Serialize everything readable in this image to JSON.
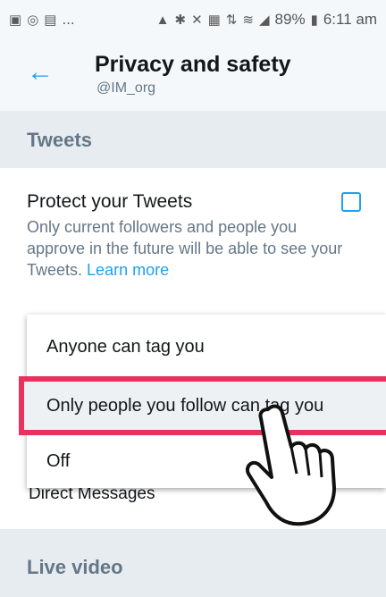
{
  "status_bar": {
    "left_text": "...",
    "battery": "89%",
    "time": "6:11 am"
  },
  "header": {
    "title": "Privacy and safety",
    "handle": "@IM_org",
    "back_icon": "arrow-left-icon"
  },
  "sections": {
    "tweets": "Tweets",
    "direct_messages": "Direct Messages",
    "live_video": "Live video"
  },
  "protect_tweets": {
    "title": "Protect your Tweets",
    "description": "Only current followers and people you approve in the future will be able to see your Tweets.",
    "learn_more": "Learn more",
    "checked": false
  },
  "photo_tagging_menu": {
    "options": [
      "Anyone can tag you",
      "Only people you follow can tag you",
      "Off"
    ],
    "highlighted_option": "Only people you follow can tag you"
  },
  "colors": {
    "accent": "#1da1f2",
    "highlight_border": "#e8315f",
    "section_bg": "#e6ecf0"
  },
  "cursor_icon": "hand-pointer-icon"
}
